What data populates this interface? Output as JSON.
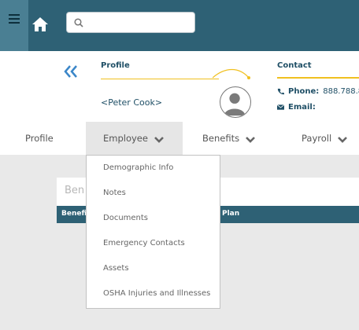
{
  "topbar": {
    "search_placeholder": ""
  },
  "header": {
    "profile_label": "Profile",
    "contact_label": "Contact",
    "employee_name": "<Peter Cook>",
    "phone_label": "Phone:",
    "phone_value": "888.788.8",
    "email_label": "Email:",
    "email_value": ""
  },
  "tabs": [
    {
      "label": "Profile"
    },
    {
      "label": "Employee"
    },
    {
      "label": "Benefits"
    },
    {
      "label": "Payroll"
    }
  ],
  "card": {
    "title": "Ben",
    "col1": "Benefi",
    "col2": "Plan"
  },
  "dropdown": {
    "items": [
      "Demographic Info",
      "Notes",
      "Documents",
      "Emergency Contacts",
      "Assets",
      "OSHA Injuries and Illnesses"
    ]
  },
  "colors": {
    "topbar": "#2e6175",
    "accent": "#f0c020",
    "link": "#3a86c8"
  },
  "icons": [
    "menu-icon",
    "home-icon",
    "search-icon",
    "double-chevron-left-icon",
    "avatar-icon",
    "phone-icon",
    "envelope-icon",
    "chevron-down-icon"
  ]
}
